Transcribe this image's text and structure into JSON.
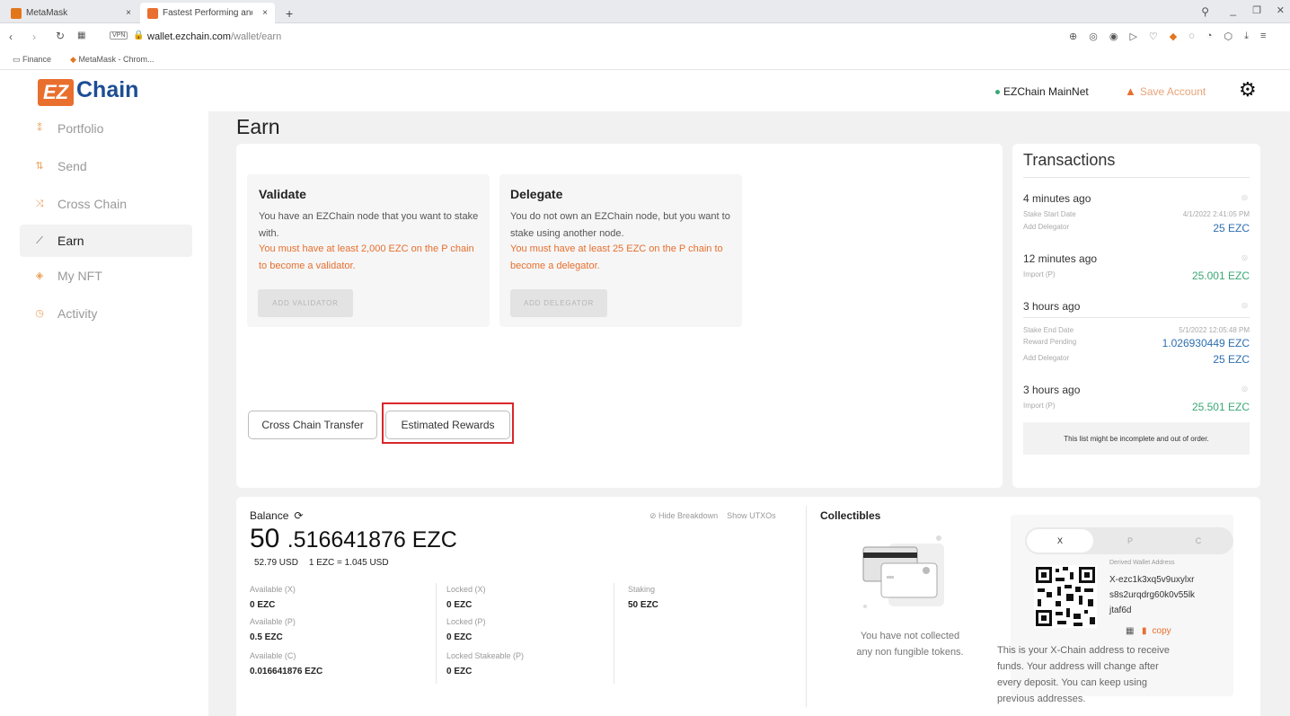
{
  "browser": {
    "tabs": [
      {
        "label": "MetaMask",
        "close": "×"
      },
      {
        "label": "Fastest Performing and Se",
        "close": "×"
      }
    ],
    "new_tab": "+",
    "url_host": "wallet.ezchain.com",
    "url_path": "/wallet/earn",
    "vpn_badge": "VPN",
    "bookmarks": [
      "Finance",
      "MetaMask - Chrom..."
    ]
  },
  "header": {
    "logo_mark": "EZ",
    "logo_text": "Chain",
    "network": "EZChain MainNet",
    "save_account": "Save Account"
  },
  "sidebar": {
    "items": [
      {
        "label": "Portfolio",
        "icon": "portfolio-icon"
      },
      {
        "label": "Send",
        "icon": "send-icon"
      },
      {
        "label": "Cross Chain",
        "icon": "cross-chain-icon"
      },
      {
        "label": "Earn",
        "icon": "earn-icon"
      },
      {
        "label": "My NFT",
        "icon": "nft-icon"
      },
      {
        "label": "Activity",
        "icon": "activity-icon"
      }
    ]
  },
  "page": {
    "title": "Earn"
  },
  "earn": {
    "validate": {
      "title": "Validate",
      "desc": "You have an EZChain node that you want to stake with.",
      "warning": "You must have at least 2,000 EZC on the P chain to become a validator.",
      "button": "ADD VALIDATOR"
    },
    "delegate": {
      "title": "Delegate",
      "desc": "You do not own an EZChain node, but you want to stake using another node.",
      "warning": "You must have at least 25 EZC on the P chain to become a delegator.",
      "button": "ADD DELEGATOR"
    },
    "cross_chain_button": "Cross Chain Transfer",
    "estimated_rewards_button": "Estimated Rewards"
  },
  "transactions": {
    "title": "Transactions",
    "items": [
      {
        "time": "4 minutes ago",
        "rows": [
          {
            "label": "Stake Start Date",
            "value": "4/1/2022 2:41:05 PM",
            "kind": "meta"
          },
          {
            "label": "Add Delegator",
            "value": "25 EZC",
            "kind": "blue"
          }
        ]
      },
      {
        "time": "12 minutes ago",
        "rows": [
          {
            "label": "Import (P)",
            "value": "25.001 EZC",
            "kind": "green"
          }
        ]
      },
      {
        "time": "3 hours ago",
        "rows": [
          {
            "label": "Stake End Date",
            "value": "5/1/2022 12:05:48 PM",
            "kind": "meta"
          },
          {
            "label": "Reward Pending",
            "value": "1.026930449 EZC",
            "kind": "blue"
          },
          {
            "label": "Add Delegator",
            "value": "25 EZC",
            "kind": "blue"
          }
        ]
      },
      {
        "time": "3 hours ago",
        "rows": [
          {
            "label": "Import (P)",
            "value": "25.501 EZC",
            "kind": "green"
          }
        ]
      }
    ],
    "footer": "This list might be incomplete and out of order."
  },
  "balance": {
    "label": "Balance",
    "hide_breakdown": "Hide Breakdown",
    "show_utxos": "Show UTXOs",
    "whole": "50",
    "fraction": ".516641876 EZC",
    "usd": "52.79 USD",
    "rate": "1 EZC = 1.045 USD",
    "col1": [
      {
        "label": "Available (X)",
        "value": "0 EZC"
      },
      {
        "label": "Available (P)",
        "value": "0.5 EZC"
      },
      {
        "label": "Available (C)",
        "value": "0.016641876 EZC"
      }
    ],
    "col2": [
      {
        "label": "Locked (X)",
        "value": "0 EZC"
      },
      {
        "label": "Locked (P)",
        "value": "0 EZC"
      },
      {
        "label": "Locked Stakeable (P)",
        "value": "0 EZC"
      }
    ],
    "col3": [
      {
        "label": "Staking",
        "value": "50 EZC"
      }
    ]
  },
  "collectibles": {
    "title": "Collectibles",
    "empty_line1": "You have not collected",
    "empty_line2": "any non fungible tokens."
  },
  "address": {
    "tabs": [
      "X",
      "P",
      "C"
    ],
    "derived_label": "Derived Wallet Address",
    "address_lines": [
      "X-ezc1k3xq5v9uxylxr",
      "s8s2urqdrg60k0v55lk",
      "jtaf6d"
    ],
    "copy": "copy",
    "info": [
      "This is your X-Chain address to receive",
      "funds. Your address will change after",
      "every deposit. You can keep using",
      "previous addresses."
    ]
  },
  "colors": {
    "accent": "#e76f2e",
    "brand_blue": "#1d4e94",
    "green": "#3aa775",
    "highlight_red": "#d9262c"
  }
}
